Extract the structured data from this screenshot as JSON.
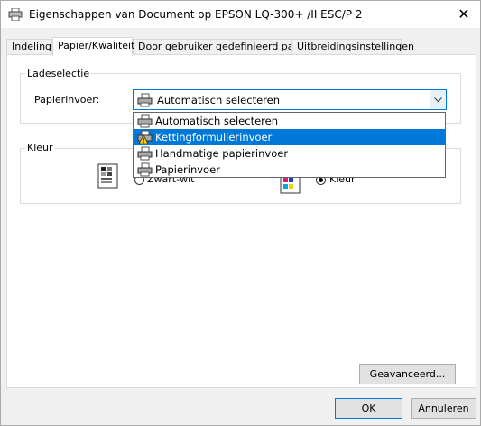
{
  "window": {
    "title": "Eigenschappen van Document op EPSON LQ-300+ /II ESC/P 2",
    "close_label": "✕"
  },
  "tabs": [
    {
      "label": "Indeling",
      "active": false
    },
    {
      "label": "Papier/Kwaliteit",
      "active": true
    },
    {
      "label": "Door gebruiker gedefinieerd papier",
      "active": false
    },
    {
      "label": "Uitbreidingsinstellingen",
      "active": false
    }
  ],
  "tray_group": {
    "label": "Ladeselectie",
    "source_label": "Papierinvoer:",
    "source_value": "Automatisch selecteren",
    "options": [
      {
        "label": "Automatisch selecteren",
        "icon": "printer-icon",
        "selected": false
      },
      {
        "label": "Kettingformulierinvoer",
        "icon": "printer-warning-icon",
        "selected": true
      },
      {
        "label": "Handmatige papierinvoer",
        "icon": "printer-icon",
        "selected": false
      },
      {
        "label": "Papierinvoer",
        "icon": "printer-icon",
        "selected": false
      }
    ]
  },
  "color_group": {
    "label": "Kleur",
    "bw_label": "Zwart-wit",
    "color_label": "Kleur",
    "selected": "color"
  },
  "buttons": {
    "advanced": "Geavanceerd...",
    "ok": "OK",
    "cancel": "Annuleren"
  },
  "colors": {
    "accent": "#0078d7",
    "selection_text": "#ffffff",
    "panel_bg": "#ffffff",
    "window_bg": "#f0f0f0"
  }
}
